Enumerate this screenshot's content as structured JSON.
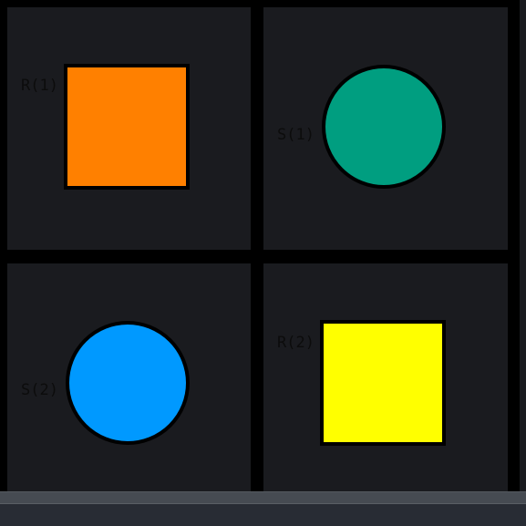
{
  "cells": [
    {
      "label": "R(1)",
      "shape": "square",
      "color": "#ff8000"
    },
    {
      "label": "S(1)",
      "shape": "circle",
      "color": "#009e80"
    },
    {
      "label": "S(2)",
      "shape": "circle",
      "color": "#0099ff"
    },
    {
      "label": "R(2)",
      "shape": "square",
      "color": "#ffff00"
    }
  ]
}
